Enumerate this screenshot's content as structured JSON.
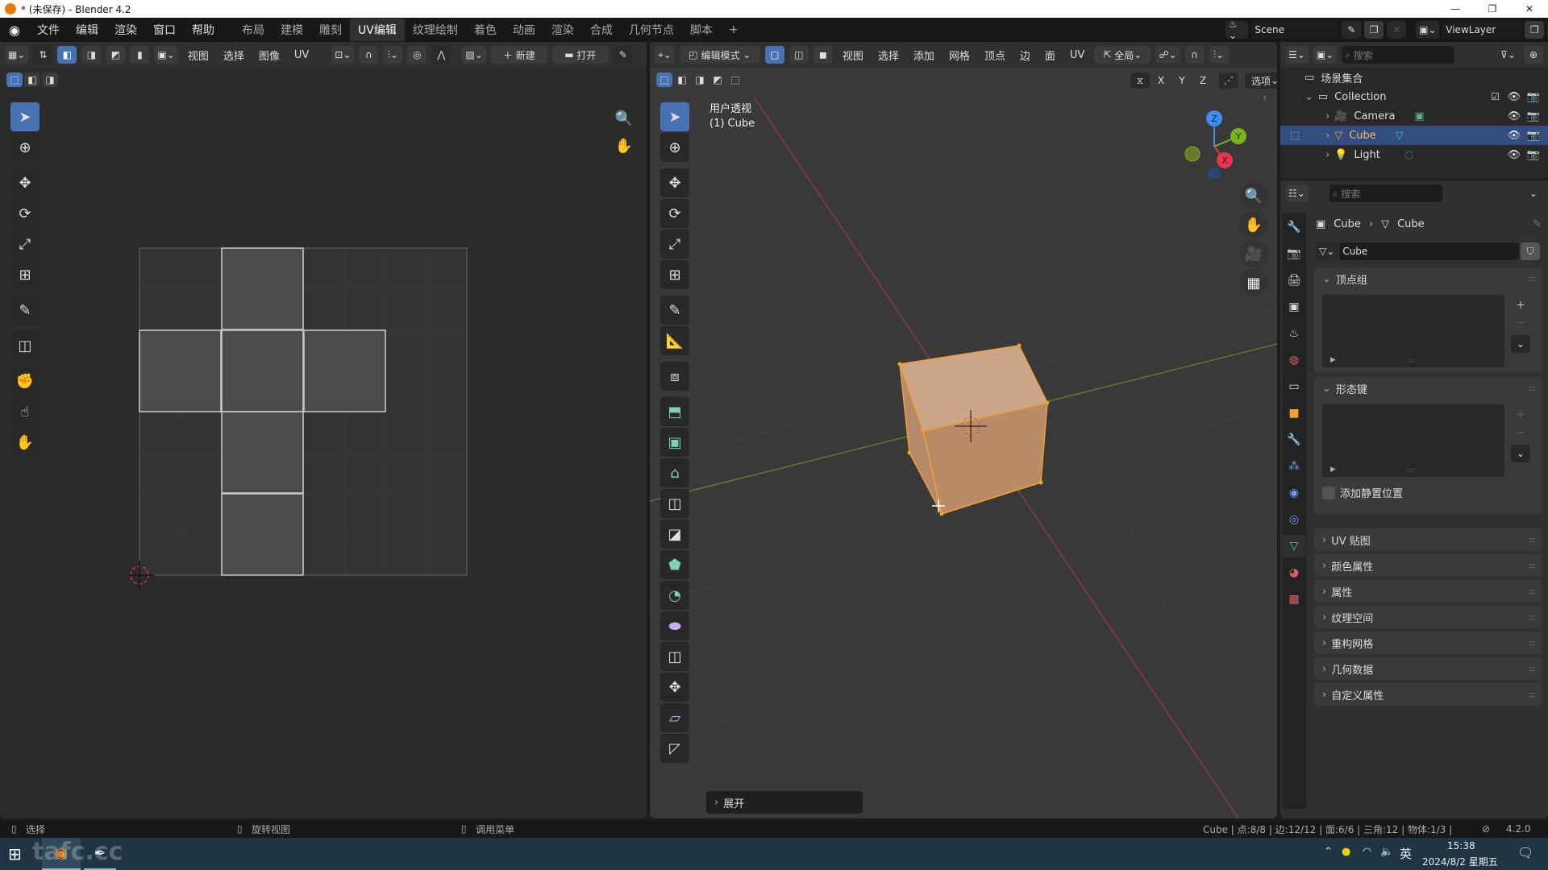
{
  "window": {
    "title": "* (未保存) - Blender 4.2"
  },
  "menubar": {
    "menus": [
      "文件",
      "编辑",
      "渲染",
      "窗口",
      "帮助"
    ],
    "workspaces": [
      "布局",
      "建模",
      "雕刻",
      "UV编辑",
      "纹理绘制",
      "着色",
      "动画",
      "渲染",
      "合成",
      "几何节点",
      "脚本"
    ],
    "active_workspace": "UV编辑",
    "add_workspace": "+",
    "scene_label": "Scene",
    "viewlayer_label": "ViewLayer"
  },
  "uv_editor": {
    "header_menus": [
      "视图",
      "选择",
      "图像",
      "UV"
    ],
    "new_label": "新建",
    "open_label": "打开",
    "tools": [
      "select-box",
      "cursor",
      "move",
      "rotate",
      "scale",
      "transform",
      "annotate",
      "rip",
      "grab",
      "relax",
      "pinch"
    ],
    "uv_faces_note": "cube unwrap cross layout"
  },
  "viewport": {
    "mode_label": "编辑模式",
    "header_menus": [
      "视图",
      "选择",
      "添加",
      "网格",
      "顶点",
      "边",
      "面",
      "UV"
    ],
    "transform_orientation": "全局",
    "axis_buttons": [
      "X",
      "Y",
      "Z"
    ],
    "options_label": "选项",
    "view_name": "用户透视",
    "object_label": "(1) Cube",
    "gizmo_axes": [
      "Z",
      "Y",
      "X"
    ],
    "last_op_panel": "展开",
    "tools": [
      "select-box",
      "cursor",
      "move",
      "rotate",
      "scale",
      "transform",
      "annotate",
      "measure",
      "add-cube",
      "extrude",
      "inset",
      "bevel",
      "loop-cut",
      "knife",
      "poly-build",
      "spin",
      "smooth",
      "edge-slide",
      "shrink-fatten",
      "shear",
      "rip-region"
    ]
  },
  "outliner": {
    "search_placeholder": "搜索",
    "root": "场景集合",
    "items": [
      {
        "name": "Collection",
        "level": 0,
        "expanded": true,
        "checked": true
      },
      {
        "name": "Camera",
        "level": 1,
        "selected": false
      },
      {
        "name": "Cube",
        "level": 1,
        "selected": true
      },
      {
        "name": "Light",
        "level": 1,
        "selected": false
      }
    ]
  },
  "properties": {
    "search_placeholder": "搜索",
    "breadcrumb": [
      "Cube",
      "Cube"
    ],
    "mesh_name": "Cube",
    "sections": {
      "vertex_groups": "顶点组",
      "shape_keys": "形态键",
      "add_rest_position": "添加静置位置"
    },
    "collapsed_sections": [
      "UV 贴图",
      "颜色属性",
      "属性",
      "纹理空间",
      "重构网格",
      "几何数据",
      "自定义属性"
    ]
  },
  "statusbar": {
    "left": "选择",
    "middle": "旋转视图",
    "right": "调用菜单",
    "stats": "Cube | 点:8/8 | 边:12/12 | 面:6/6 | 三角:12 | 物体:1/3 |",
    "version": "4.2.0"
  },
  "taskbar": {
    "ime": "英",
    "time": "15:38",
    "date": "2024/8/2 星期五",
    "watermark": "tafc.cc"
  },
  "colors": {
    "accent": "#4772b3",
    "selected_orange": "#f0a030",
    "axis_x": "#e8344d",
    "axis_y": "#7ab317",
    "axis_z": "#3e8eef"
  }
}
